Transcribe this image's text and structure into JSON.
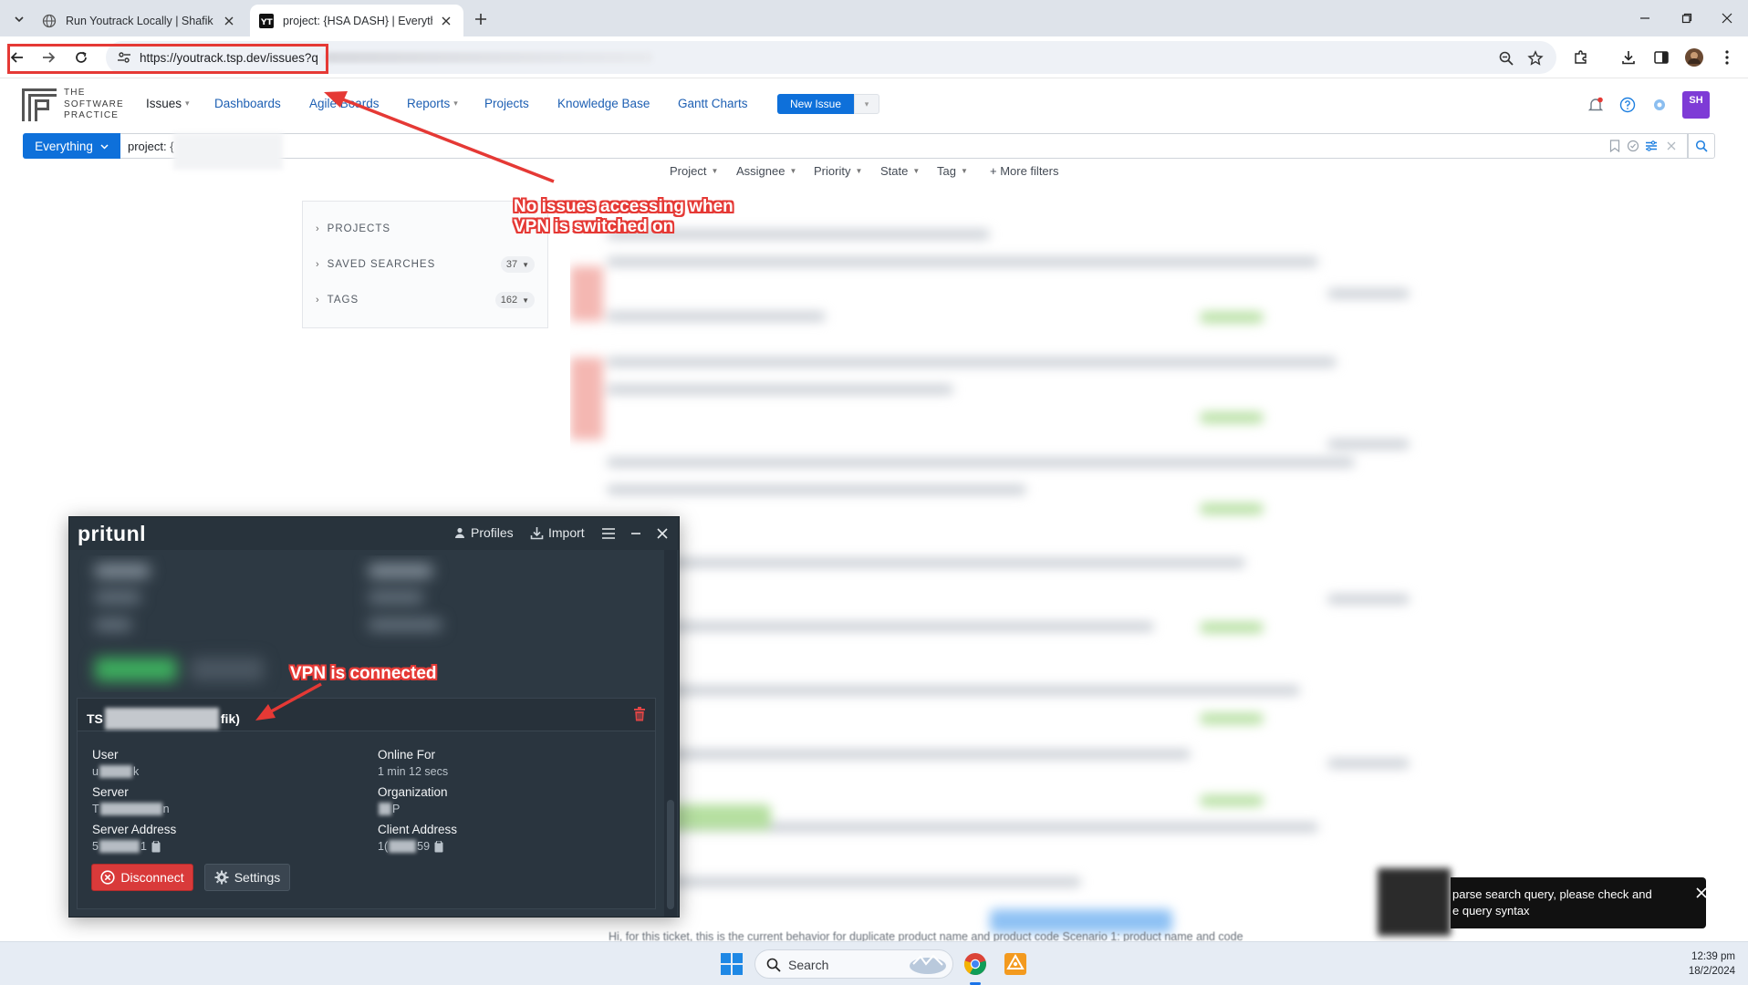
{
  "browser": {
    "tabs": [
      {
        "title": "Run Youtrack Locally | Shafik W"
      },
      {
        "title": "project: {HSA DASH} | Everythin"
      }
    ],
    "url": "https://youtrack.tsp.dev/issues?q"
  },
  "youtrack": {
    "logo_lines": [
      "THE",
      "SOFTWARE",
      "PRACTICE"
    ],
    "nav": {
      "issues": "Issues",
      "dashboards": "Dashboards",
      "agile_boards": "Agile Boards",
      "reports": "Reports",
      "projects": "Projects",
      "knowledge_base": "Knowledge Base",
      "gantt_charts": "Gantt Charts"
    },
    "new_issue": "New Issue",
    "avatar_initials": "SH",
    "search": {
      "context": "Everything",
      "query": "project: {"
    },
    "filters": [
      "Project",
      "Assignee",
      "Priority",
      "State",
      "Tag"
    ],
    "more_filters": "+ More filters",
    "sidebar": {
      "projects": "PROJECTS",
      "saved_searches": "SAVED SEARCHES",
      "saved_searches_count": "37",
      "tags": "TAGS",
      "tags_count": "162"
    },
    "bottom_text": "Hi, for this ticket, this is the current behavior for duplicate product name and product code Scenario 1: product name and code"
  },
  "annotations": {
    "no_issues": [
      "No issues accessing when",
      "VPN is switched on"
    ],
    "vpn_connected": "VPN is connected"
  },
  "pritunl": {
    "app_name": "pritunl",
    "profiles": "Profiles",
    "import": "Import",
    "profile_name_prefix": "TS",
    "profile_name_suffix": "fik)",
    "fields": {
      "user_label": "User",
      "user_prefix": "u",
      "user_suffix": "k",
      "server_label": "Server",
      "server_prefix": "T",
      "server_suffix": "n",
      "server_address_label": "Server Address",
      "server_address_prefix": "5",
      "server_address_suffix": "1",
      "online_for_label": "Online For",
      "online_for_value": "1 min 12 secs",
      "organization_label": "Organization",
      "organization_value": "P",
      "client_address_label": "Client Address",
      "client_address_prefix": "1(",
      "client_address_suffix": "59"
    },
    "disconnect": "Disconnect",
    "settings": "Settings"
  },
  "toast": {
    "line1": "parse search query, please check and",
    "line2": "e query syntax"
  },
  "taskbar": {
    "search_placeholder": "Search",
    "time": "12:39 pm",
    "date": "18/2/2024"
  },
  "colors": {
    "accent": "#0e70da",
    "annotation_red": "#e53935",
    "pritunl_bg": "#2d3943",
    "disconnect_red": "#d93a3a",
    "avatar_purple": "#7e3bd6"
  }
}
